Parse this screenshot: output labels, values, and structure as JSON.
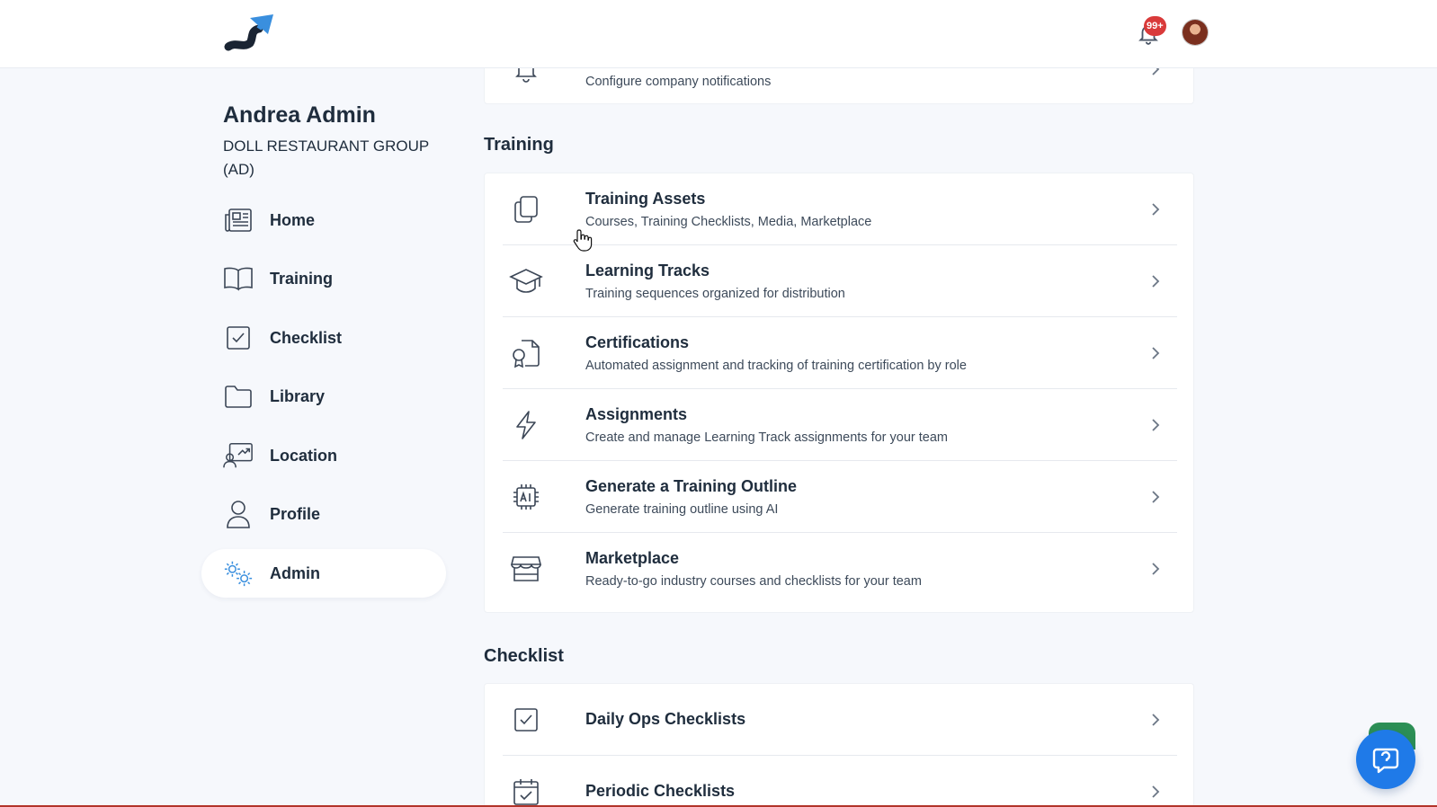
{
  "header": {
    "notification_count": "99+"
  },
  "user": {
    "name": "Andrea Admin",
    "org": "DOLL RESTAURANT GROUP (AD)"
  },
  "nav": {
    "items": [
      {
        "label": "Home",
        "icon": "newspaper-icon"
      },
      {
        "label": "Training",
        "icon": "book-icon"
      },
      {
        "label": "Checklist",
        "icon": "checkbox-icon"
      },
      {
        "label": "Library",
        "icon": "folder-icon"
      },
      {
        "label": "Location",
        "icon": "location-person-icon"
      },
      {
        "label": "Profile",
        "icon": "person-icon"
      },
      {
        "label": "Admin",
        "icon": "gears-icon",
        "active": true
      }
    ]
  },
  "top_card": {
    "subtitle": "Configure company notifications",
    "icon": "bell-icon"
  },
  "training_section": {
    "title": "Training",
    "rows": [
      {
        "title": "Training Assets",
        "subtitle": "Courses, Training Checklists, Media, Marketplace",
        "icon": "copy-icon"
      },
      {
        "title": "Learning Tracks",
        "subtitle": "Training sequences organized for distribution",
        "icon": "graduation-cap-icon"
      },
      {
        "title": "Certifications",
        "subtitle": "Automated assignment and tracking of training certification by role",
        "icon": "certificate-icon"
      },
      {
        "title": "Assignments",
        "subtitle": "Create and manage Learning Track assignments for your team",
        "icon": "lightning-icon"
      },
      {
        "title": "Generate a Training Outline",
        "subtitle": "Generate training outline using AI",
        "icon": "ai-chip-icon"
      },
      {
        "title": "Marketplace",
        "subtitle": "Ready-to-go industry courses and checklists for your team",
        "icon": "store-icon"
      }
    ]
  },
  "checklist_section": {
    "title": "Checklist",
    "rows": [
      {
        "title": "Daily Ops Checklists",
        "icon": "checkbox-icon"
      },
      {
        "title": "Periodic Checklists",
        "icon": "calendar-check-icon"
      }
    ]
  },
  "colors": {
    "accent": "#1f7ae8",
    "logo_blue": "#3a8fde",
    "text": "#1f2d3d",
    "badge": "#d93a3a"
  }
}
